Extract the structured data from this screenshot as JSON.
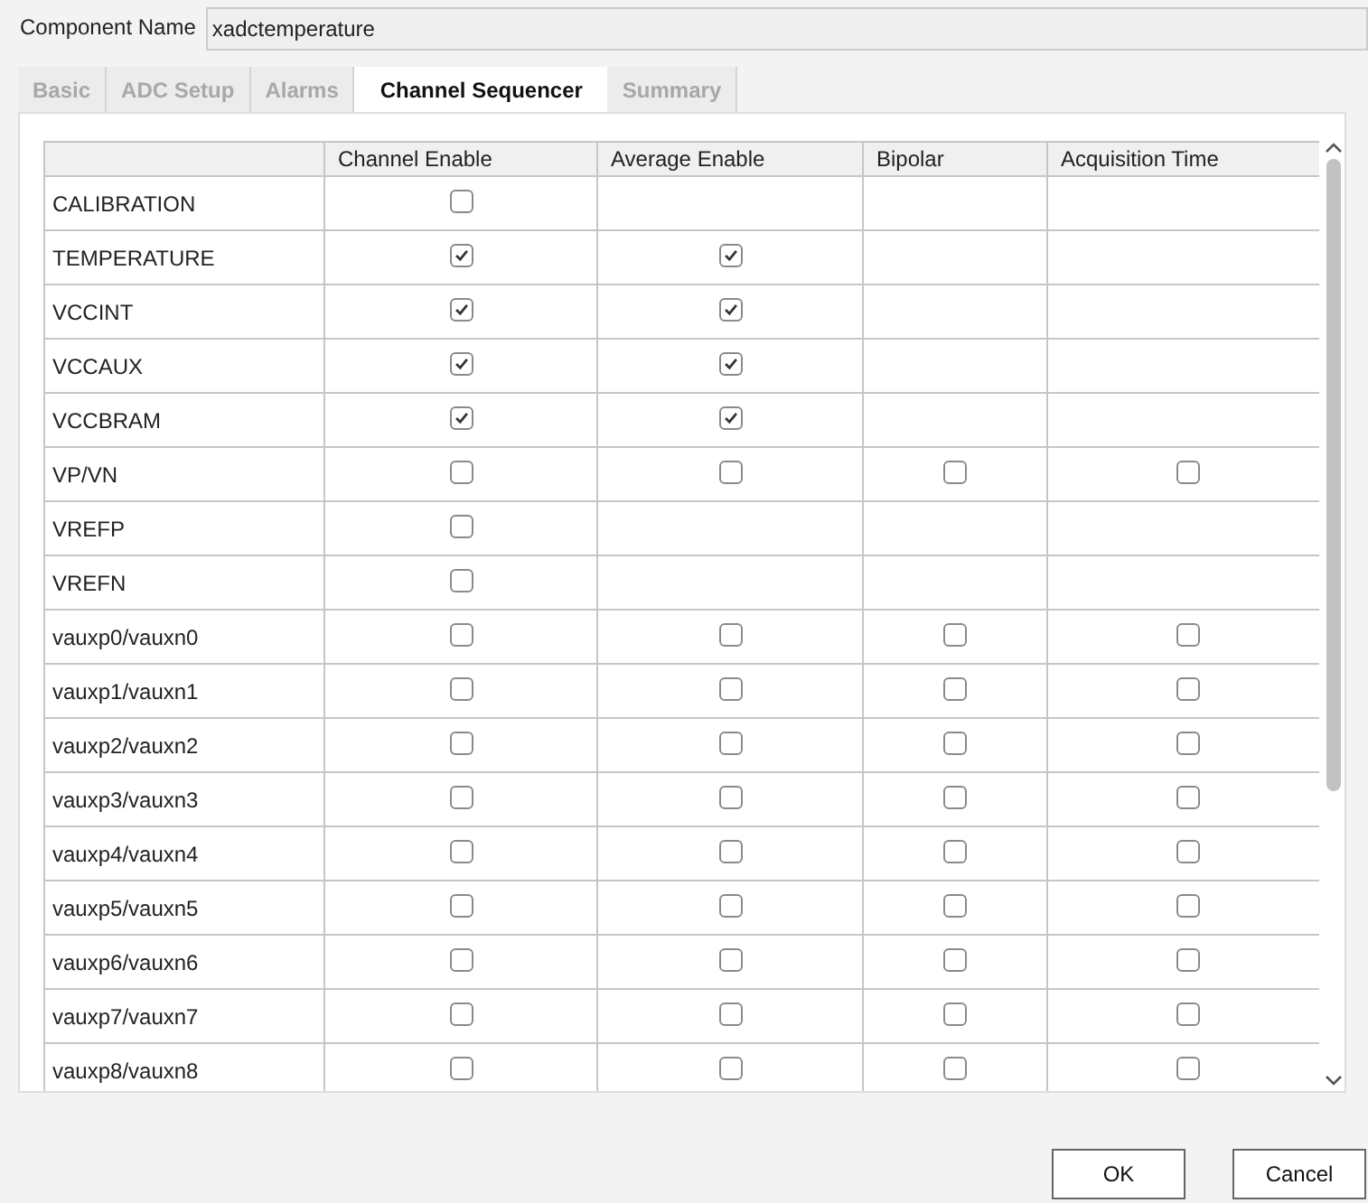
{
  "component_name": {
    "label": "Component Name",
    "value": "xadctemperature"
  },
  "tabs": [
    {
      "label": "Basic",
      "selected": false
    },
    {
      "label": "ADC Setup",
      "selected": false
    },
    {
      "label": "Alarms",
      "selected": false
    },
    {
      "label": "Channel Sequencer",
      "selected": true
    },
    {
      "label": "Summary",
      "selected": false
    }
  ],
  "table": {
    "columns": [
      "Channel Enable",
      "Average Enable",
      "Bipolar",
      "Acquisition Time"
    ],
    "rows": [
      {
        "name": "CALIBRATION",
        "cells": [
          {
            "kind": "checkbox",
            "checked": false
          },
          {
            "kind": "empty"
          },
          {
            "kind": "empty"
          },
          {
            "kind": "empty"
          }
        ]
      },
      {
        "name": "TEMPERATURE",
        "cells": [
          {
            "kind": "checkbox",
            "checked": true
          },
          {
            "kind": "checkbox",
            "checked": true
          },
          {
            "kind": "empty"
          },
          {
            "kind": "empty"
          }
        ]
      },
      {
        "name": "VCCINT",
        "cells": [
          {
            "kind": "checkbox",
            "checked": true
          },
          {
            "kind": "checkbox",
            "checked": true
          },
          {
            "kind": "empty"
          },
          {
            "kind": "empty"
          }
        ]
      },
      {
        "name": "VCCAUX",
        "cells": [
          {
            "kind": "checkbox",
            "checked": true
          },
          {
            "kind": "checkbox",
            "checked": true
          },
          {
            "kind": "empty"
          },
          {
            "kind": "empty"
          }
        ]
      },
      {
        "name": "VCCBRAM",
        "cells": [
          {
            "kind": "checkbox",
            "checked": true
          },
          {
            "kind": "checkbox",
            "checked": true
          },
          {
            "kind": "empty"
          },
          {
            "kind": "empty"
          }
        ]
      },
      {
        "name": "VP/VN",
        "cells": [
          {
            "kind": "checkbox",
            "checked": false
          },
          {
            "kind": "checkbox",
            "checked": false
          },
          {
            "kind": "checkbox",
            "checked": false
          },
          {
            "kind": "checkbox",
            "checked": false
          }
        ]
      },
      {
        "name": "VREFP",
        "cells": [
          {
            "kind": "checkbox",
            "checked": false
          },
          {
            "kind": "empty"
          },
          {
            "kind": "empty"
          },
          {
            "kind": "empty"
          }
        ]
      },
      {
        "name": "VREFN",
        "cells": [
          {
            "kind": "checkbox",
            "checked": false
          },
          {
            "kind": "empty"
          },
          {
            "kind": "empty"
          },
          {
            "kind": "empty"
          }
        ]
      },
      {
        "name": "vauxp0/vauxn0",
        "cells": [
          {
            "kind": "checkbox",
            "checked": false
          },
          {
            "kind": "checkbox",
            "checked": false
          },
          {
            "kind": "checkbox",
            "checked": false
          },
          {
            "kind": "checkbox",
            "checked": false
          }
        ]
      },
      {
        "name": "vauxp1/vauxn1",
        "cells": [
          {
            "kind": "checkbox",
            "checked": false
          },
          {
            "kind": "checkbox",
            "checked": false
          },
          {
            "kind": "checkbox",
            "checked": false
          },
          {
            "kind": "checkbox",
            "checked": false
          }
        ]
      },
      {
        "name": "vauxp2/vauxn2",
        "cells": [
          {
            "kind": "checkbox",
            "checked": false
          },
          {
            "kind": "checkbox",
            "checked": false
          },
          {
            "kind": "checkbox",
            "checked": false
          },
          {
            "kind": "checkbox",
            "checked": false
          }
        ]
      },
      {
        "name": "vauxp3/vauxn3",
        "cells": [
          {
            "kind": "checkbox",
            "checked": false
          },
          {
            "kind": "checkbox",
            "checked": false
          },
          {
            "kind": "checkbox",
            "checked": false
          },
          {
            "kind": "checkbox",
            "checked": false
          }
        ]
      },
      {
        "name": "vauxp4/vauxn4",
        "cells": [
          {
            "kind": "checkbox",
            "checked": false
          },
          {
            "kind": "checkbox",
            "checked": false
          },
          {
            "kind": "checkbox",
            "checked": false
          },
          {
            "kind": "checkbox",
            "checked": false
          }
        ]
      },
      {
        "name": "vauxp5/vauxn5",
        "cells": [
          {
            "kind": "checkbox",
            "checked": false
          },
          {
            "kind": "checkbox",
            "checked": false
          },
          {
            "kind": "checkbox",
            "checked": false
          },
          {
            "kind": "checkbox",
            "checked": false
          }
        ]
      },
      {
        "name": "vauxp6/vauxn6",
        "cells": [
          {
            "kind": "checkbox",
            "checked": false
          },
          {
            "kind": "checkbox",
            "checked": false
          },
          {
            "kind": "checkbox",
            "checked": false
          },
          {
            "kind": "checkbox",
            "checked": false
          }
        ]
      },
      {
        "name": "vauxp7/vauxn7",
        "cells": [
          {
            "kind": "checkbox",
            "checked": false
          },
          {
            "kind": "checkbox",
            "checked": false
          },
          {
            "kind": "checkbox",
            "checked": false
          },
          {
            "kind": "checkbox",
            "checked": false
          }
        ]
      },
      {
        "name": "vauxp8/vauxn8",
        "cells": [
          {
            "kind": "checkbox",
            "checked": false
          },
          {
            "kind": "checkbox",
            "checked": false
          },
          {
            "kind": "checkbox",
            "checked": false
          },
          {
            "kind": "checkbox",
            "checked": false
          }
        ]
      }
    ]
  },
  "buttons": [
    "OK",
    "Cancel"
  ]
}
